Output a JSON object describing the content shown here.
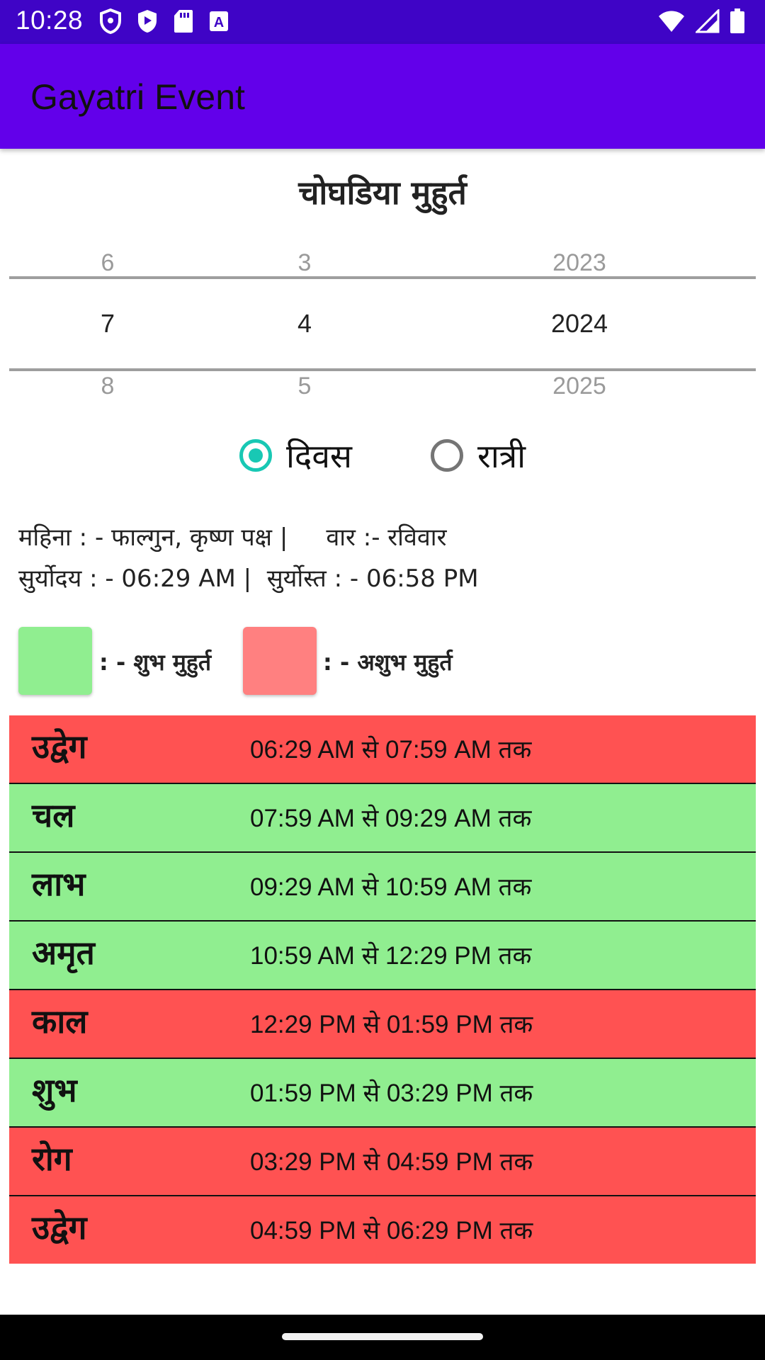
{
  "status_bar": {
    "time": "10:28",
    "left_icons": [
      "shield-icon",
      "play-protect-icon",
      "sd-card-icon",
      "keyboard-a-icon"
    ],
    "right_icons": [
      "wifi-icon",
      "cell-signal-icon",
      "battery-icon"
    ]
  },
  "app_bar": {
    "title": "Gayatri Event"
  },
  "page_title": "चोघडिया मुहुर्त",
  "date_picker": {
    "day": {
      "prev": "6",
      "current": "7",
      "next": "8"
    },
    "month": {
      "prev": "3",
      "current": "4",
      "next": "5"
    },
    "year": {
      "prev": "2023",
      "current": "2024",
      "next": "2025"
    }
  },
  "mode_toggle": {
    "options": [
      {
        "label": "दिवस",
        "checked": true
      },
      {
        "label": "रात्री",
        "checked": false
      }
    ],
    "accent_color": "#18c8b4"
  },
  "info": {
    "line1": "महिना : - फाल्गुन, कृष्ण पक्ष |     वार :- रविवार",
    "line2": "सुर्योदय : - 06:29 AM |  सुर्योस्त : - 06:58 PM"
  },
  "legend": {
    "auspicious_label": ": - शुभ मुहुर्त",
    "inauspicious_label": ": - अशुभ मुहुर्त",
    "auspicious_color": "#90ee90",
    "inauspicious_color": "#ff8080"
  },
  "colors": {
    "status_bar": "#3f04c6",
    "app_bar": "#6200ea",
    "row_good": "#90ee90",
    "row_bad": "#ff5252"
  },
  "muhurat_rows": [
    {
      "name": "उद्वेग",
      "time": "06:29 AM से 07:59 AM तक",
      "type": "bad"
    },
    {
      "name": "चल",
      "time": "07:59 AM से 09:29 AM तक",
      "type": "good"
    },
    {
      "name": "लाभ",
      "time": "09:29 AM से 10:59 AM तक",
      "type": "good"
    },
    {
      "name": "अमृत",
      "time": "10:59 AM से 12:29 PM तक",
      "type": "good"
    },
    {
      "name": "काल",
      "time": "12:29 PM से 01:59 PM तक",
      "type": "bad"
    },
    {
      "name": "शुभ",
      "time": "01:59 PM से 03:29 PM तक",
      "type": "good"
    },
    {
      "name": "रोग",
      "time": "03:29 PM से 04:59 PM तक",
      "type": "bad"
    },
    {
      "name": "उद्वेग",
      "time": "04:59 PM से 06:29 PM तक",
      "type": "bad"
    }
  ]
}
